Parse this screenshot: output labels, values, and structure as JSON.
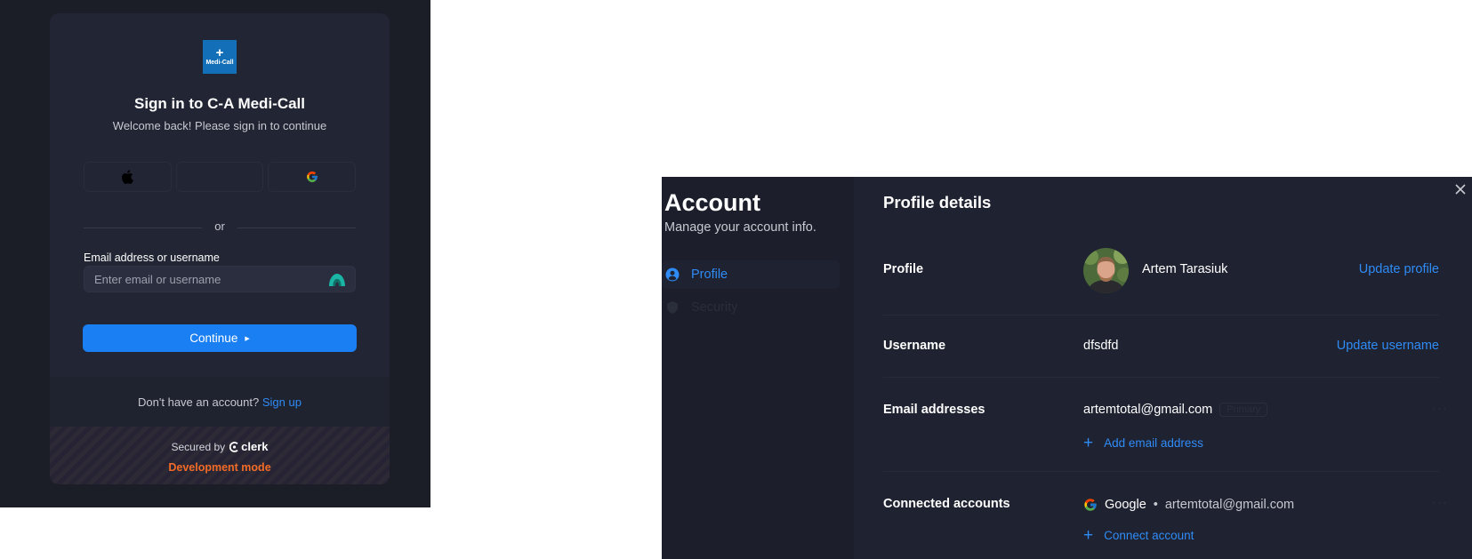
{
  "signin": {
    "logo_text": "Medi-Call",
    "title": "Sign in to C-A Medi-Call",
    "subtitle": "Welcome back! Please sign in to continue",
    "divider_text": "or",
    "email_label": "Email address or username",
    "email_placeholder": "Enter email or username",
    "continue_label": "Continue",
    "signup_prompt": "Don't have an account?",
    "signup_link": "Sign up",
    "secured_by": "Secured by",
    "secured_brand": "clerk",
    "dev_mode": "Development mode",
    "social_buttons": [
      "apple-icon",
      "blank",
      "google-icon"
    ]
  },
  "account": {
    "title": "Account",
    "subtitle": "Manage your account info.",
    "nav": [
      {
        "label": "Profile",
        "icon": "user-circle-icon",
        "active": true
      },
      {
        "label": "Security",
        "icon": "shield-icon",
        "active": false
      }
    ],
    "section_title": "Profile details",
    "profile": {
      "label": "Profile",
      "name": "Artem Tarasiuk",
      "action": "Update profile"
    },
    "username": {
      "label": "Username",
      "value": "dfsdfd",
      "action": "Update username"
    },
    "emails": {
      "label": "Email addresses",
      "value": "artemtotal@gmail.com",
      "badge": "Primary",
      "add": "Add email address"
    },
    "connected": {
      "label": "Connected accounts",
      "provider": "Google",
      "email": "artemtotal@gmail.com",
      "add": "Connect account"
    }
  },
  "colors": {
    "accent": "#2f8cf7",
    "button": "#1a7ff2",
    "dev_mode": "#f26b27",
    "logo": "#1370b8"
  }
}
